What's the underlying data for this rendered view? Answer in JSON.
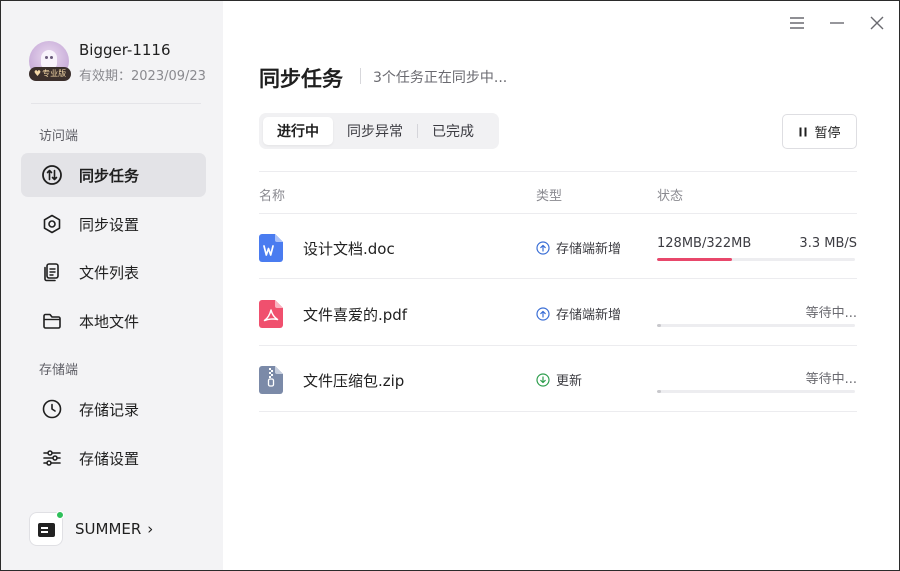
{
  "window": {
    "controls": [
      "menu-icon",
      "minimize-icon",
      "close-icon"
    ]
  },
  "sidebar": {
    "user": {
      "name": "Bigger-1116",
      "badge": "专业版",
      "expiry": "有效期：2023/09/23"
    },
    "sections": [
      {
        "label": "访问端",
        "items": [
          {
            "label": "同步任务",
            "icon": "sync-icon",
            "active": true
          },
          {
            "label": "同步设置",
            "icon": "hexagon-settings-icon",
            "active": false
          },
          {
            "label": "文件列表",
            "icon": "file-list-icon",
            "active": false
          },
          {
            "label": "本地文件",
            "icon": "folder-icon",
            "active": false
          }
        ]
      },
      {
        "label": "存储端",
        "items": [
          {
            "label": "存储记录",
            "icon": "clock-icon",
            "active": false
          },
          {
            "label": "存储设置",
            "icon": "sliders-icon",
            "active": false
          }
        ]
      }
    ],
    "device": {
      "name": "SUMMER",
      "chevron": "›",
      "online": true
    }
  },
  "main": {
    "title": "同步任务",
    "subtitle": "3个任务正在同步中...",
    "tabs": [
      {
        "label": "进行中",
        "active": true
      },
      {
        "label": "同步异常",
        "active": false
      },
      {
        "label": "已完成",
        "active": false
      }
    ],
    "pause_label": "暂停",
    "columns": {
      "name": "名称",
      "type": "类型",
      "status": "状态"
    },
    "rows": [
      {
        "file": "设计文档.doc",
        "file_icon": "word-file-icon",
        "type": "存储端新增",
        "type_icon": "upload-circle-icon",
        "size": "128MB/322MB",
        "speed": "3.3 MB/S",
        "progress": 0.38,
        "state": ""
      },
      {
        "file": "文件喜爱的.pdf",
        "file_icon": "pdf-file-icon",
        "type": "存储端新增",
        "type_icon": "upload-circle-icon",
        "size": "",
        "speed": "",
        "progress": 0.02,
        "state": "等待中..."
      },
      {
        "file": "文件压缩包.zip",
        "file_icon": "zip-file-icon",
        "type": "更新",
        "type_icon": "download-circle-icon",
        "size": "",
        "speed": "",
        "progress": 0.02,
        "state": "等待中..."
      }
    ]
  },
  "colors": {
    "accent": "#e8476b",
    "upload_icon": "#3b6fd6",
    "update_icon": "#2f9e4e",
    "sidebar_bg": "#f3f3f5",
    "active_nav": "#e3e3e7"
  }
}
